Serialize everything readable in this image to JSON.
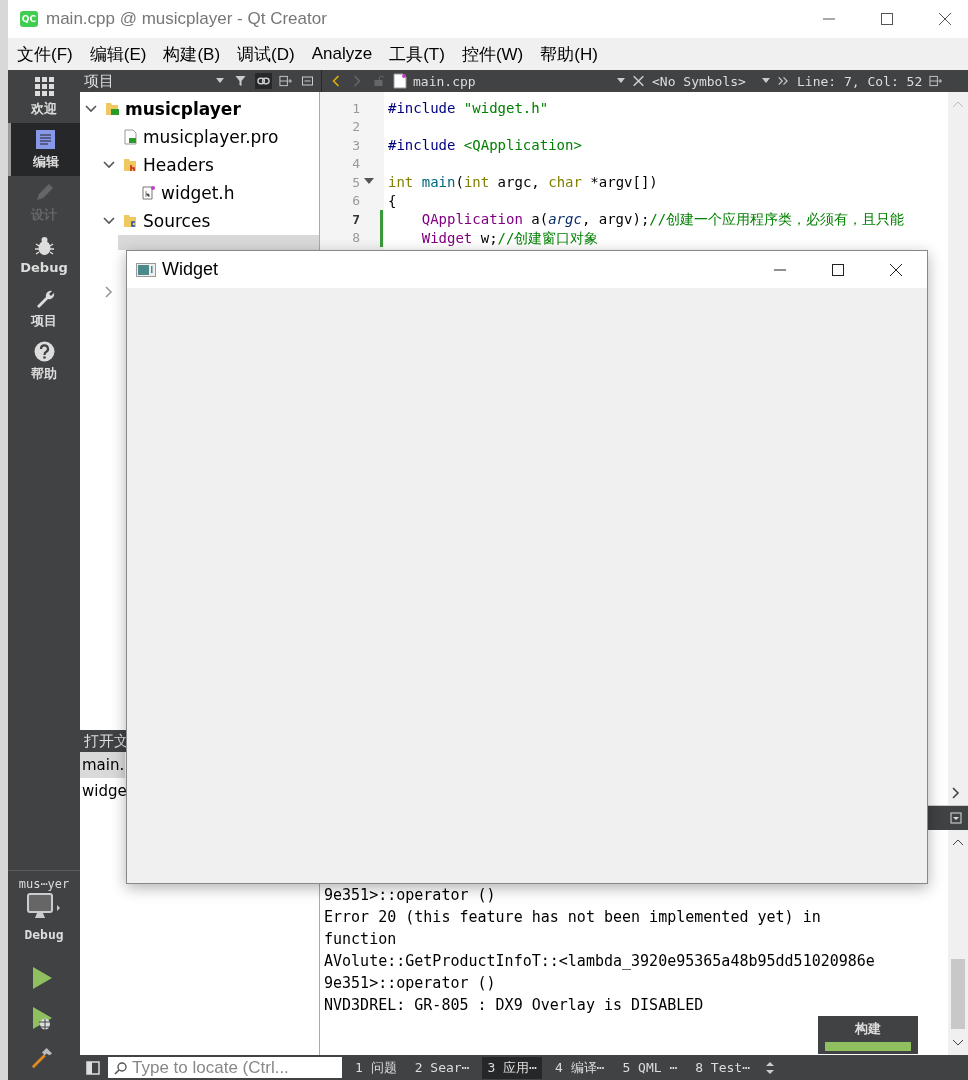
{
  "window": {
    "logo": "QC",
    "title": "main.cpp @ musicplayer - Qt Creator"
  },
  "menu": [
    "文件(F)",
    "编辑(E)",
    "构建(B)",
    "调试(D)",
    "Analyze",
    "工具(T)",
    "控件(W)",
    "帮助(H)"
  ],
  "toolbar": {
    "pane_title": "项目",
    "file": "main.cpp",
    "symbols": "<No Symbols>",
    "cursor": "Line: 7, Col: 52"
  },
  "modes": [
    {
      "label": "欢迎",
      "selected": false,
      "disabled": false
    },
    {
      "label": "编辑",
      "selected": true,
      "disabled": false
    },
    {
      "label": "设计",
      "selected": false,
      "disabled": true
    },
    {
      "label": "Debug",
      "selected": false,
      "disabled": false
    },
    {
      "label": "项目",
      "selected": false,
      "disabled": false
    },
    {
      "label": "帮助",
      "selected": false,
      "disabled": false
    }
  ],
  "kit": {
    "project": "mus⋯yer",
    "build": "Debug"
  },
  "tree": [
    {
      "label": "musicplayer",
      "kind": "project",
      "expanded": true,
      "children": [
        {
          "label": "musicplayer.pro",
          "kind": "pro"
        },
        {
          "label": "Headers",
          "kind": "headers",
          "expanded": true,
          "children": [
            {
              "label": "widget.h",
              "kind": "file"
            }
          ]
        },
        {
          "label": "Sources",
          "kind": "sources",
          "expanded": true,
          "children": [
            {
              "kind": "hidden",
              "selected": true
            }
          ]
        },
        {
          "kind": "hidden",
          "expanded": false
        }
      ]
    }
  ],
  "open_documents": {
    "title": "打开文",
    "items": [
      {
        "label": "main.",
        "selected": true
      },
      {
        "label": "widge",
        "selected": false
      }
    ]
  },
  "code": [
    {
      "number": "1",
      "tokens": [
        {
          "kind": "preproc",
          "text": "#include "
        },
        {
          "kind": "string",
          "text": "\"widget.h\""
        }
      ]
    },
    {
      "number": "2"
    },
    {
      "number": "3",
      "tokens": [
        {
          "kind": "preproc",
          "text": "#include "
        },
        {
          "kind": "string",
          "text": "<QApplication>"
        }
      ]
    },
    {
      "number": "4"
    },
    {
      "number": "5",
      "fold": true,
      "tokens": [
        {
          "kind": "keyword",
          "text": "int"
        },
        {
          "kind": "func",
          "text": " main"
        },
        {
          "kind": "plain",
          "text": "("
        },
        {
          "kind": "keyword",
          "text": "int"
        },
        {
          "kind": "plain",
          "text": " argc, "
        },
        {
          "kind": "keyword",
          "text": "char"
        },
        {
          "kind": "plain",
          "text": " *argv[])"
        }
      ]
    },
    {
      "number": "6",
      "tokens": [
        {
          "kind": "plain",
          "text": "{"
        }
      ]
    },
    {
      "number": "7",
      "changed": true,
      "current": true,
      "tokens": [
        {
          "kind": "type",
          "text": "    QApplication"
        },
        {
          "kind": "plain",
          "text": " a("
        },
        {
          "kind": "param",
          "text": "argc"
        },
        {
          "kind": "plain",
          "text": ", argv);"
        },
        {
          "kind": "comment",
          "text": "//创建一个应用程序类，必须有，且只能"
        }
      ]
    },
    {
      "number": "8",
      "changed": true,
      "tokens": [
        {
          "kind": "type",
          "text": "    Widget"
        },
        {
          "kind": "plain",
          "text": " w;"
        },
        {
          "kind": "comment",
          "text": "//创建窗口对象"
        }
      ]
    }
  ],
  "output": [
    "9e351>::operator ()",
    "Error 20 (this feature has not been implemented yet) in",
    "function",
    "AVolute::GetProductInfoT::<lambda_3920e95365a48b95dd51020986e",
    "9e351>::operator ()",
    "NVD3DREL: GR-805 : DX9 Overlay is DISABLED"
  ],
  "status_bar": {
    "locate_placeholder": "Type to locate (Ctrl...",
    "tabs": [
      {
        "label": "1 问题",
        "selected": false
      },
      {
        "label": "2 Sear⋯",
        "selected": false
      },
      {
        "label": "3 应用⋯",
        "selected": true
      },
      {
        "label": "4 编译⋯",
        "selected": false
      },
      {
        "label": "5 QML ⋯",
        "selected": false
      },
      {
        "label": "8 Test⋯",
        "selected": false
      }
    ]
  },
  "build_progress": {
    "label": "构建",
    "level": 1
  },
  "widget_window": {
    "title": "Widget"
  }
}
